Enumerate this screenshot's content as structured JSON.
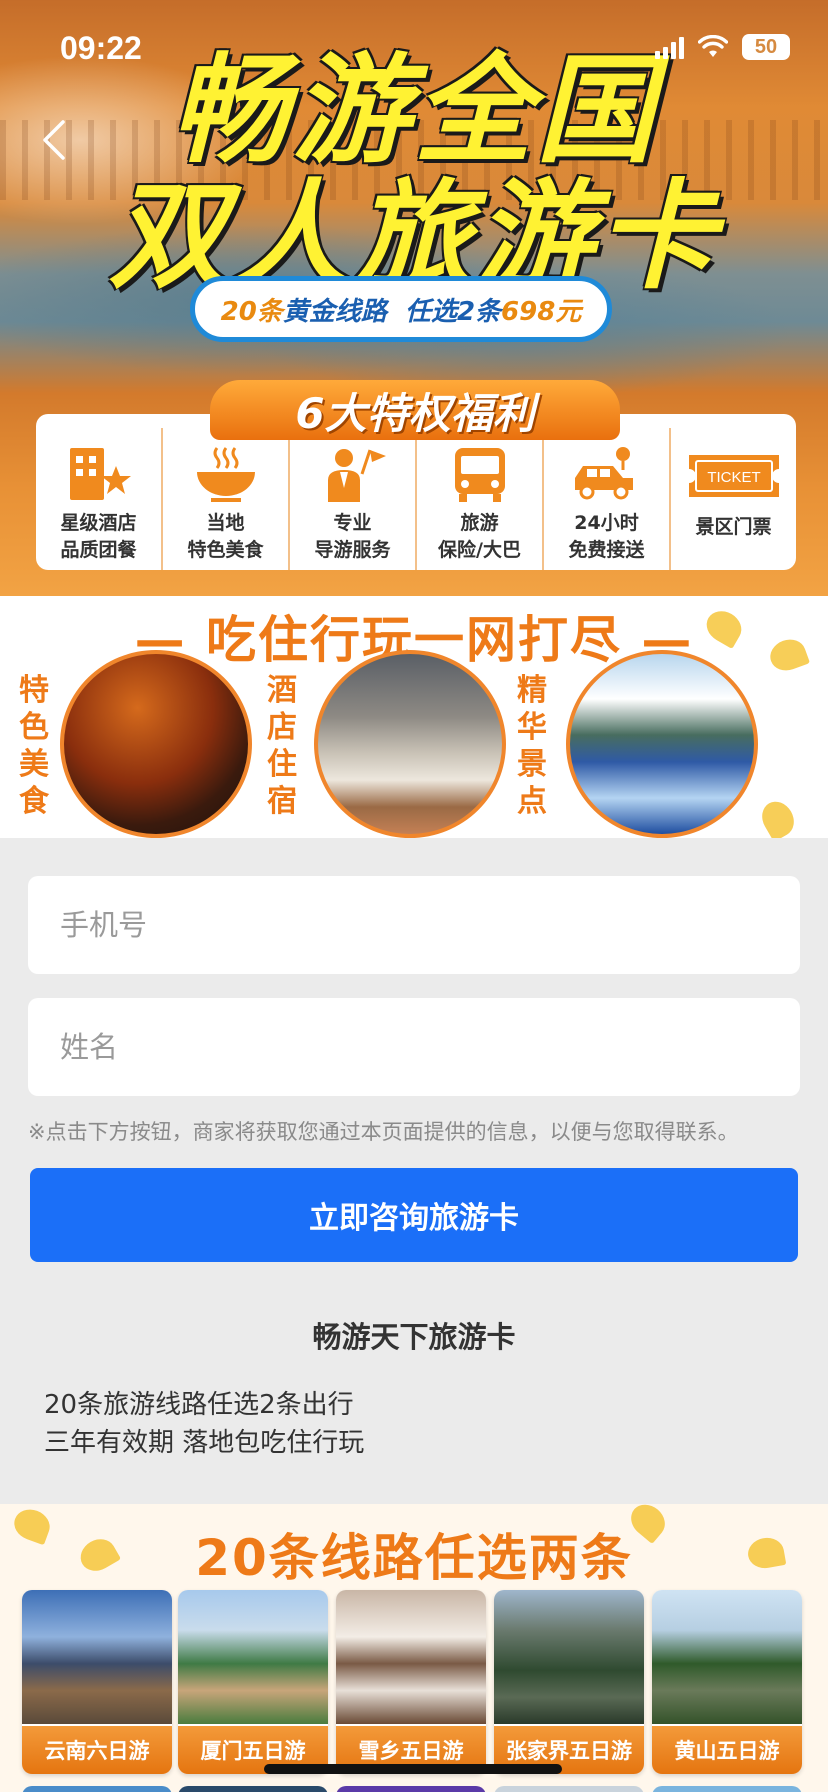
{
  "status_bar": {
    "time": "09:22",
    "battery": "50"
  },
  "hero": {
    "title_line1": "畅游全国",
    "title_line2": "双人旅游卡",
    "pill_part1": "20条",
    "pill_part2": "黄金线路  任选2条",
    "pill_part3": "698元",
    "privilege_title": "6大特权福利",
    "privileges": [
      {
        "icon": "hotel-star-icon",
        "label": "星级酒店\n品质团餐"
      },
      {
        "icon": "food-bowl-icon",
        "label": "当地\n特色美食"
      },
      {
        "icon": "tour-guide-icon",
        "label": "专业\n导游服务"
      },
      {
        "icon": "bus-icon",
        "label": "旅游\n保险/大巴"
      },
      {
        "icon": "car-pickup-icon",
        "label": "24小时\n免费接送"
      },
      {
        "icon": "ticket-icon",
        "label": "景区门票",
        "ticket_text": "TICKET"
      }
    ]
  },
  "features": {
    "title": "— 吃住行玩一网打尽 —",
    "items": [
      {
        "label": "特色美食",
        "image": "food-photo"
      },
      {
        "label": "酒店住宿",
        "image": "hotel-photo"
      },
      {
        "label": "精华景点",
        "image": "sight-photo"
      }
    ]
  },
  "form": {
    "phone_placeholder": "手机号",
    "name_placeholder": "姓名",
    "phone_value": "",
    "name_value": "",
    "notice": "※点击下方按钮，商家将获取您通过本页面提供的信息，以便与您取得联系。",
    "submit_label": "立即咨询旅游卡"
  },
  "card": {
    "title": "畅游天下旅游卡",
    "desc_line1": "20条旅游线路任选2条出行",
    "desc_line2": "三年有效期 落地包吃住行玩"
  },
  "routes": {
    "title": "20条线路任选两条",
    "items": [
      {
        "label": "云南六日游"
      },
      {
        "label": "厦门五日游"
      },
      {
        "label": "雪乡五日游"
      },
      {
        "label": "张家界五日游"
      },
      {
        "label": "黄山五日游"
      }
    ]
  },
  "colors": {
    "accent_orange": "#ee7a18",
    "button_blue": "#1b6ff8",
    "title_yellow": "#fff233"
  }
}
